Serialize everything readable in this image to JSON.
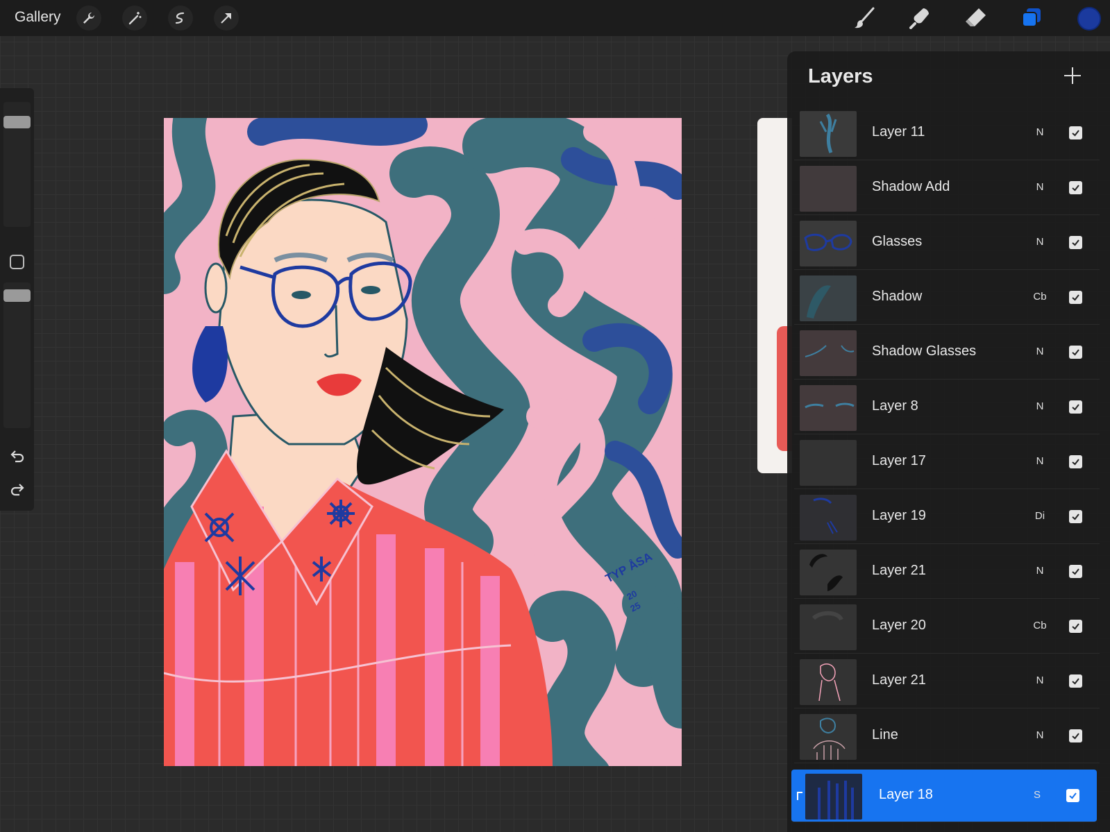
{
  "topbar": {
    "gallery_label": "Gallery",
    "left_tools": [
      "wrench-icon",
      "magic-wand-icon",
      "selection-icon",
      "transform-arrow-icon"
    ],
    "right_tools": [
      "brush-icon",
      "smudge-icon",
      "eraser-icon",
      "layers-icon"
    ],
    "current_color": "#1b3a9e",
    "active_tool_color": "#1774f0"
  },
  "artwork": {
    "signature": "TYP ÅSA 2025"
  },
  "layers_panel": {
    "title": "Layers",
    "layers": [
      {
        "name": "Layer 11",
        "mode": "N",
        "visible": true,
        "selected": false
      },
      {
        "name": "Shadow Add",
        "mode": "N",
        "visible": true,
        "selected": false
      },
      {
        "name": "Glasses",
        "mode": "N",
        "visible": true,
        "selected": false
      },
      {
        "name": "Shadow",
        "mode": "Cb",
        "visible": true,
        "selected": false
      },
      {
        "name": "Shadow Glasses",
        "mode": "N",
        "visible": true,
        "selected": false
      },
      {
        "name": "Layer 8",
        "mode": "N",
        "visible": true,
        "selected": false
      },
      {
        "name": "Layer 17",
        "mode": "N",
        "visible": true,
        "selected": false
      },
      {
        "name": "Layer 19",
        "mode": "Di",
        "visible": true,
        "selected": false
      },
      {
        "name": "Layer 21",
        "mode": "N",
        "visible": true,
        "selected": false
      },
      {
        "name": "Layer 20",
        "mode": "Cb",
        "visible": true,
        "selected": false
      },
      {
        "name": "Layer 21",
        "mode": "N",
        "visible": true,
        "selected": false
      },
      {
        "name": "Line",
        "mode": "N",
        "visible": true,
        "selected": false
      },
      {
        "name": "Layer 18",
        "mode": "S",
        "visible": true,
        "selected": true
      }
    ]
  },
  "colors": {
    "canvas_pink": "#f2b3c6",
    "swirl_teal": "#3e6f7c",
    "swirl_blue": "#2d4f9a",
    "shirt_red": "#f2554f",
    "shirt_pink": "#f77fb3",
    "skin": "#fbd9c4"
  }
}
